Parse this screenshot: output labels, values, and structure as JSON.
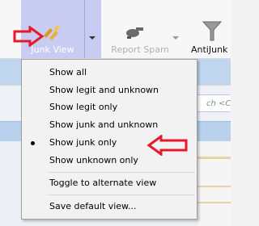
{
  "toolbar": {
    "junk_view_label": "Junk View",
    "report_spam_label": "Report Spam",
    "antijunk_label": "AntiJunk"
  },
  "background": {
    "search_hint": "ch <Ctrl"
  },
  "menu": {
    "items": [
      {
        "label": "Show all",
        "selected": false
      },
      {
        "label": "Show legit and unknown",
        "selected": false
      },
      {
        "label": "Show legit only",
        "selected": false
      },
      {
        "label": "Show junk and unknown",
        "selected": false
      },
      {
        "label": "Show junk only",
        "selected": true
      },
      {
        "label": "Show unknown only",
        "selected": false
      },
      {
        "label": "Toggle to alternate view",
        "selected": false
      },
      {
        "label": "Save default view...",
        "selected": false
      }
    ]
  },
  "colors": {
    "annotation_red": "#e8182b",
    "selected_button_bg": "#c9ccf2"
  },
  "icons": [
    "junk-view-icon",
    "report-spam-icon",
    "antijunk-funnel-icon",
    "dropdown-caret-icon",
    "radio-bullet-icon"
  ]
}
